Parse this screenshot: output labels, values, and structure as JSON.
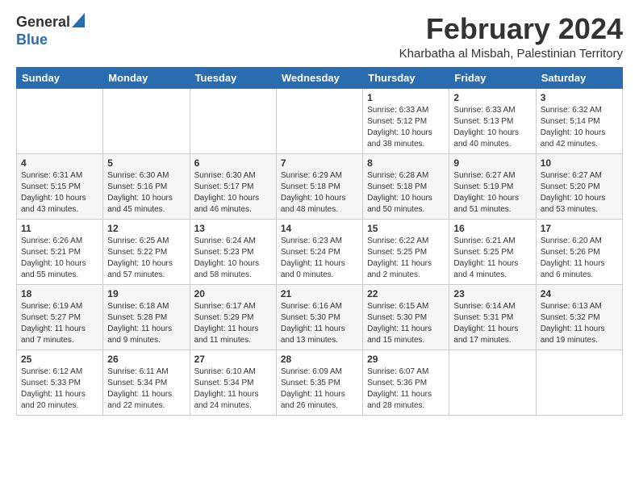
{
  "logo": {
    "general": "General",
    "blue": "Blue"
  },
  "title": {
    "month_year": "February 2024",
    "location": "Kharbatha al Misbah, Palestinian Territory"
  },
  "headers": [
    "Sunday",
    "Monday",
    "Tuesday",
    "Wednesday",
    "Thursday",
    "Friday",
    "Saturday"
  ],
  "weeks": [
    [
      {
        "day": "",
        "info": ""
      },
      {
        "day": "",
        "info": ""
      },
      {
        "day": "",
        "info": ""
      },
      {
        "day": "",
        "info": ""
      },
      {
        "day": "1",
        "info": "Sunrise: 6:33 AM\nSunset: 5:12 PM\nDaylight: 10 hours\nand 38 minutes."
      },
      {
        "day": "2",
        "info": "Sunrise: 6:33 AM\nSunset: 5:13 PM\nDaylight: 10 hours\nand 40 minutes."
      },
      {
        "day": "3",
        "info": "Sunrise: 6:32 AM\nSunset: 5:14 PM\nDaylight: 10 hours\nand 42 minutes."
      }
    ],
    [
      {
        "day": "4",
        "info": "Sunrise: 6:31 AM\nSunset: 5:15 PM\nDaylight: 10 hours\nand 43 minutes."
      },
      {
        "day": "5",
        "info": "Sunrise: 6:30 AM\nSunset: 5:16 PM\nDaylight: 10 hours\nand 45 minutes."
      },
      {
        "day": "6",
        "info": "Sunrise: 6:30 AM\nSunset: 5:17 PM\nDaylight: 10 hours\nand 46 minutes."
      },
      {
        "day": "7",
        "info": "Sunrise: 6:29 AM\nSunset: 5:18 PM\nDaylight: 10 hours\nand 48 minutes."
      },
      {
        "day": "8",
        "info": "Sunrise: 6:28 AM\nSunset: 5:18 PM\nDaylight: 10 hours\nand 50 minutes."
      },
      {
        "day": "9",
        "info": "Sunrise: 6:27 AM\nSunset: 5:19 PM\nDaylight: 10 hours\nand 51 minutes."
      },
      {
        "day": "10",
        "info": "Sunrise: 6:27 AM\nSunset: 5:20 PM\nDaylight: 10 hours\nand 53 minutes."
      }
    ],
    [
      {
        "day": "11",
        "info": "Sunrise: 6:26 AM\nSunset: 5:21 PM\nDaylight: 10 hours\nand 55 minutes."
      },
      {
        "day": "12",
        "info": "Sunrise: 6:25 AM\nSunset: 5:22 PM\nDaylight: 10 hours\nand 57 minutes."
      },
      {
        "day": "13",
        "info": "Sunrise: 6:24 AM\nSunset: 5:23 PM\nDaylight: 10 hours\nand 58 minutes."
      },
      {
        "day": "14",
        "info": "Sunrise: 6:23 AM\nSunset: 5:24 PM\nDaylight: 11 hours\nand 0 minutes."
      },
      {
        "day": "15",
        "info": "Sunrise: 6:22 AM\nSunset: 5:25 PM\nDaylight: 11 hours\nand 2 minutes."
      },
      {
        "day": "16",
        "info": "Sunrise: 6:21 AM\nSunset: 5:25 PM\nDaylight: 11 hours\nand 4 minutes."
      },
      {
        "day": "17",
        "info": "Sunrise: 6:20 AM\nSunset: 5:26 PM\nDaylight: 11 hours\nand 6 minutes."
      }
    ],
    [
      {
        "day": "18",
        "info": "Sunrise: 6:19 AM\nSunset: 5:27 PM\nDaylight: 11 hours\nand 7 minutes."
      },
      {
        "day": "19",
        "info": "Sunrise: 6:18 AM\nSunset: 5:28 PM\nDaylight: 11 hours\nand 9 minutes."
      },
      {
        "day": "20",
        "info": "Sunrise: 6:17 AM\nSunset: 5:29 PM\nDaylight: 11 hours\nand 11 minutes."
      },
      {
        "day": "21",
        "info": "Sunrise: 6:16 AM\nSunset: 5:30 PM\nDaylight: 11 hours\nand 13 minutes."
      },
      {
        "day": "22",
        "info": "Sunrise: 6:15 AM\nSunset: 5:30 PM\nDaylight: 11 hours\nand 15 minutes."
      },
      {
        "day": "23",
        "info": "Sunrise: 6:14 AM\nSunset: 5:31 PM\nDaylight: 11 hours\nand 17 minutes."
      },
      {
        "day": "24",
        "info": "Sunrise: 6:13 AM\nSunset: 5:32 PM\nDaylight: 11 hours\nand 19 minutes."
      }
    ],
    [
      {
        "day": "25",
        "info": "Sunrise: 6:12 AM\nSunset: 5:33 PM\nDaylight: 11 hours\nand 20 minutes."
      },
      {
        "day": "26",
        "info": "Sunrise: 6:11 AM\nSunset: 5:34 PM\nDaylight: 11 hours\nand 22 minutes."
      },
      {
        "day": "27",
        "info": "Sunrise: 6:10 AM\nSunset: 5:34 PM\nDaylight: 11 hours\nand 24 minutes."
      },
      {
        "day": "28",
        "info": "Sunrise: 6:09 AM\nSunset: 5:35 PM\nDaylight: 11 hours\nand 26 minutes."
      },
      {
        "day": "29",
        "info": "Sunrise: 6:07 AM\nSunset: 5:36 PM\nDaylight: 11 hours\nand 28 minutes."
      },
      {
        "day": "",
        "info": ""
      },
      {
        "day": "",
        "info": ""
      }
    ]
  ]
}
